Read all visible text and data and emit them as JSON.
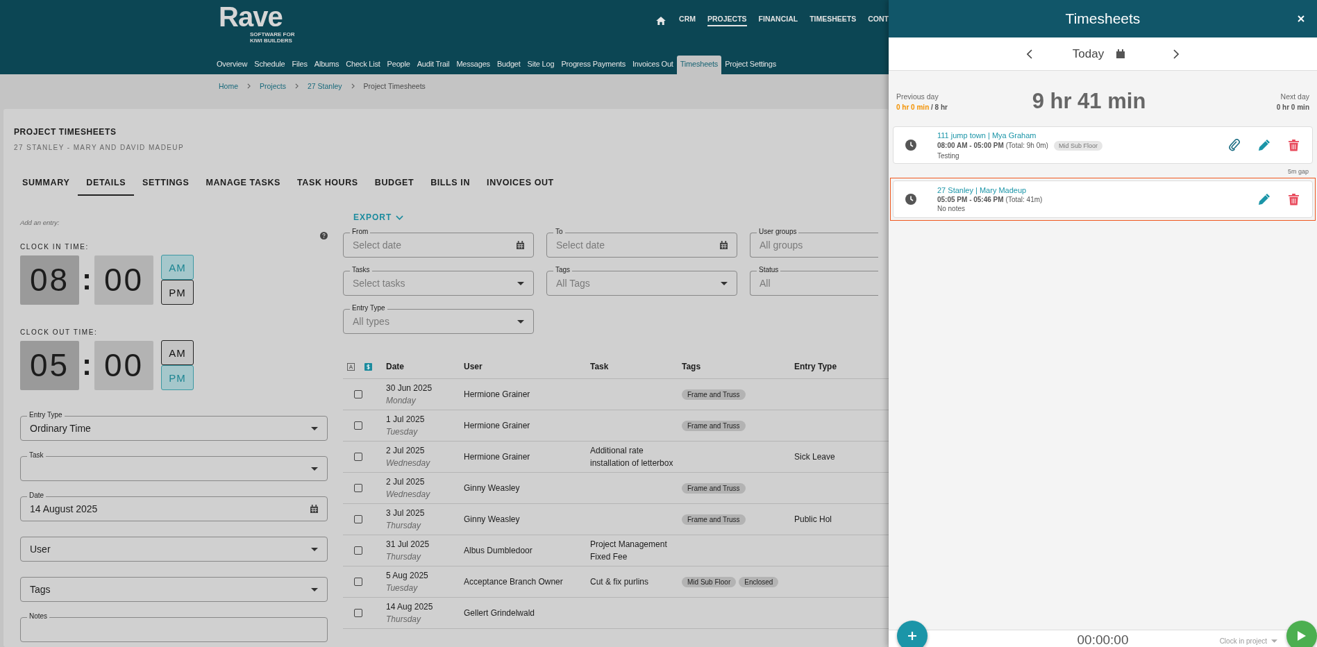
{
  "header": {
    "logo": "Rave",
    "tagline": [
      "SOFTWARE FOR",
      "KIWI BUILDERS"
    ],
    "top_nav": [
      {
        "label": "CRM",
        "selected": false
      },
      {
        "label": "PROJECTS",
        "selected": true
      },
      {
        "label": "FINANCIAL",
        "selected": false
      },
      {
        "label": "TIMESHEETS",
        "selected": false
      },
      {
        "label": "CONT",
        "selected": false
      }
    ],
    "project_nav": [
      {
        "label": "Overview",
        "selected": false
      },
      {
        "label": "Schedule",
        "selected": false
      },
      {
        "label": "Files",
        "selected": false
      },
      {
        "label": "Albums",
        "selected": false
      },
      {
        "label": "Check List",
        "selected": false
      },
      {
        "label": "People",
        "selected": false
      },
      {
        "label": "Audit Trail",
        "selected": false
      },
      {
        "label": "Messages",
        "selected": false
      },
      {
        "label": "Budget",
        "selected": false
      },
      {
        "label": "Site Log",
        "selected": false
      },
      {
        "label": "Progress Payments",
        "selected": false
      },
      {
        "label": "Invoices Out",
        "selected": false
      },
      {
        "label": "Timesheets",
        "selected": true
      },
      {
        "label": "Project Settings",
        "selected": false
      }
    ]
  },
  "breadcrumbs": [
    {
      "label": "Home",
      "kind": "link"
    },
    {
      "label": "Projects",
      "kind": "link"
    },
    {
      "label": "27 Stanley",
      "kind": "link"
    },
    {
      "label": "Project Timesheets",
      "kind": "current"
    }
  ],
  "page": {
    "title": "PROJECT TIMESHEETS",
    "subtitle": "27 STANLEY - MARY AND DAVID MADEUP",
    "tabs": [
      {
        "label": "SUMMARY",
        "selected": false
      },
      {
        "label": "DETAILS",
        "selected": true
      },
      {
        "label": "SETTINGS",
        "selected": false
      },
      {
        "label": "MANAGE TASKS",
        "selected": false
      },
      {
        "label": "TASK HOURS",
        "selected": false
      },
      {
        "label": "BUDGET",
        "selected": false
      },
      {
        "label": "BILLS IN",
        "selected": false
      },
      {
        "label": "INVOICES OUT",
        "selected": false
      }
    ]
  },
  "entry_form": {
    "hint": "Add an entry:",
    "clocks": [
      {
        "label": "CLOCK IN TIME:",
        "hour": "08",
        "separator": ":",
        "minute": "00",
        "periods": [
          {
            "label": "AM",
            "selected": true
          },
          {
            "label": "PM",
            "selected": false
          }
        ]
      },
      {
        "label": "CLOCK OUT TIME:",
        "hour": "05",
        "separator": ":",
        "minute": "00",
        "periods": [
          {
            "label": "AM",
            "selected": false
          },
          {
            "label": "PM",
            "selected": true
          }
        ]
      }
    ],
    "fields": [
      {
        "kind": "select",
        "label": "Entry Type",
        "value": "Ordinary Time"
      },
      {
        "kind": "select",
        "label": "Task"
      },
      {
        "kind": "date",
        "label": "Date",
        "value": "14 August 2025"
      },
      {
        "kind": "select",
        "placeholder": "User"
      },
      {
        "kind": "select",
        "placeholder": "Tags"
      },
      {
        "kind": "text",
        "label": "Notes"
      }
    ]
  },
  "filters": {
    "export": "EXPORT",
    "fields": [
      {
        "kind": "date",
        "label": "From",
        "placeholder": "Select date"
      },
      {
        "kind": "date",
        "label": "To",
        "placeholder": "Select date"
      },
      {
        "kind": "partial",
        "label": "User groups",
        "placeholder": "All groups"
      },
      {
        "kind": "select",
        "label": "Tasks",
        "placeholder": "Select tasks"
      },
      {
        "kind": "select",
        "label": "Tags",
        "placeholder": "All Tags"
      },
      {
        "kind": "partial",
        "label": "Status",
        "placeholder": "All"
      },
      {
        "kind": "select",
        "label": "Entry Type",
        "placeholder": "All types"
      }
    ]
  },
  "table": {
    "columns": [
      "Date",
      "User",
      "Task",
      "Tags",
      "Entry Type"
    ],
    "rows": [
      {
        "checked": false,
        "date": "30 Jun 2025",
        "day": "Monday",
        "user": "Hermione Grainer",
        "task": "",
        "tags": [
          "Frame and Truss"
        ],
        "entry_type": ""
      },
      {
        "checked": false,
        "date": "1 Jul 2025",
        "day": "Tuesday",
        "user": "Hermione Grainer",
        "task": "",
        "tags": [
          "Frame and Truss"
        ],
        "entry_type": ""
      },
      {
        "checked": false,
        "date": "2 Jul 2025",
        "day": "Wednesday",
        "user": "Hermione Grainer",
        "task": "Additional rate installation of letterbox",
        "tags": [],
        "entry_type": "Sick Leave"
      },
      {
        "checked": false,
        "date": "2 Jul 2025",
        "day": "Wednesday",
        "user": "Ginny Weasley",
        "task": "",
        "tags": [
          "Frame and Truss"
        ],
        "entry_type": ""
      },
      {
        "checked": false,
        "date": "3 Jul 2025",
        "day": "Thursday",
        "user": "Ginny Weasley",
        "task": "",
        "tags": [
          "Frame and Truss"
        ],
        "entry_type": "Public Hol"
      },
      {
        "checked": false,
        "date": "31 Jul 2025",
        "day": "Thursday",
        "user": "Albus Dumbledoor",
        "task": "Project Management Fixed Fee",
        "tags": [],
        "entry_type": ""
      },
      {
        "checked": false,
        "date": "5 Aug 2025",
        "day": "Tuesday",
        "user": "Acceptance Branch Owner",
        "task": "Cut & fix purlins",
        "tags": [
          "Mid Sub Floor",
          "Enclosed"
        ],
        "entry_type": ""
      },
      {
        "checked": false,
        "date": "14 Aug 2025",
        "day": "Thursday",
        "user": "Gellert Grindelwald",
        "task": "",
        "tags": [],
        "entry_type": ""
      }
    ]
  },
  "drawer": {
    "title": "Timesheets",
    "day": "Today",
    "summary": {
      "previous_label": "Previous day",
      "previous_worked": "0 hr 0 min",
      "previous_target": "/ 8 hr",
      "total": "9 hr 41 min",
      "next_label": "Next day",
      "next_value": "0 hr 0 min"
    },
    "entries": [
      {
        "title": "111 jump town | Mya Graham",
        "time": "08:00 AM - 05:00 PM",
        "total": "(Total: 9h 0m)",
        "tag": "Mid Sub Floor",
        "notes": "Testing",
        "attachment": true,
        "highlighted": false,
        "gap_after": "5m gap"
      },
      {
        "title": "27 Stanley | Mary Madeup",
        "time": "05:05 PM - 05:46 PM",
        "total": "(Total: 41m)",
        "notes": "No notes",
        "attachment": false,
        "highlighted": true
      }
    ],
    "timer": "00:00:00",
    "clock_in_select": "Clock in project"
  }
}
